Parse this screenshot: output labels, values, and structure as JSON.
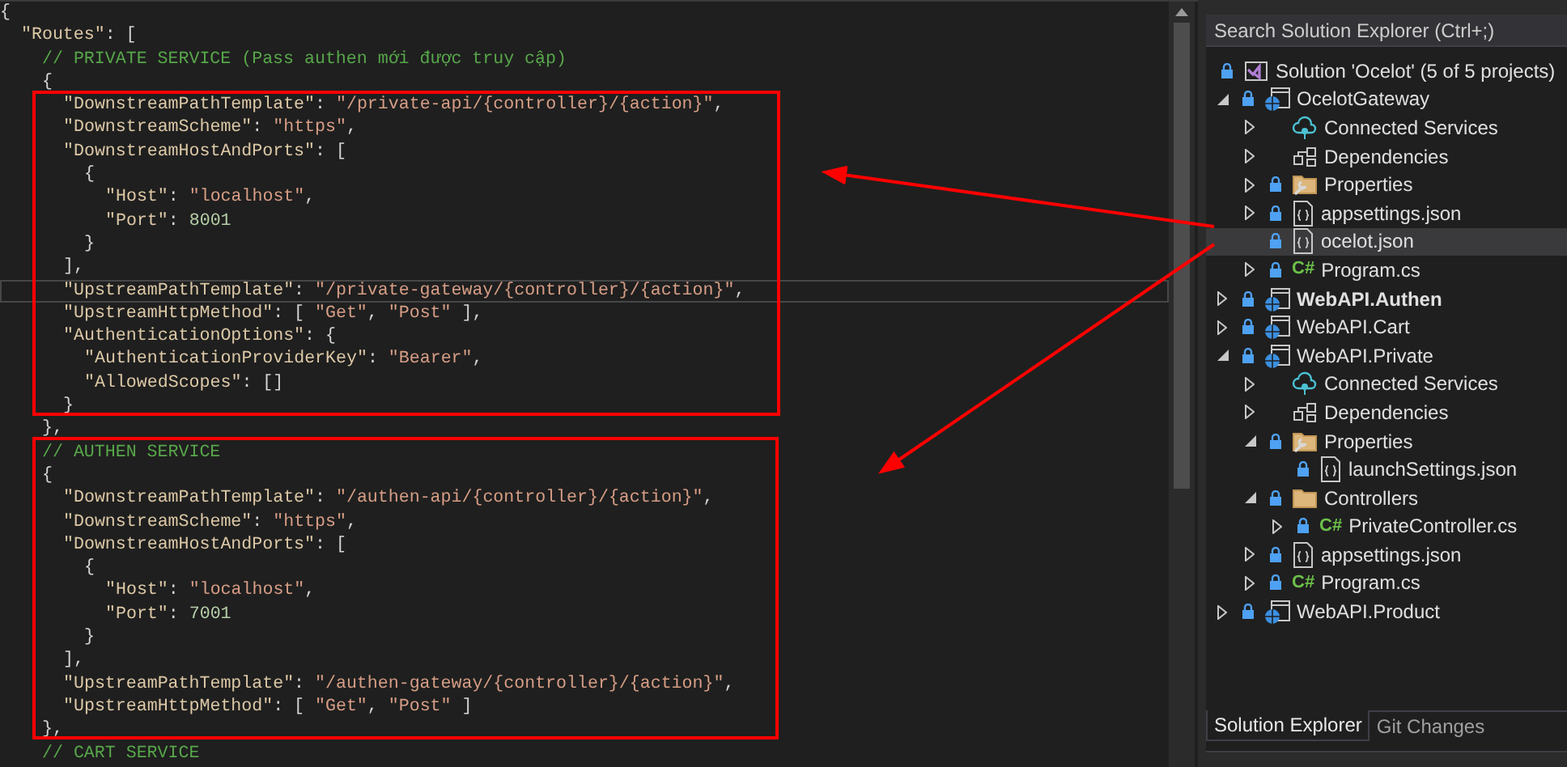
{
  "editor": {
    "lines": [
      {
        "tokens": [
          {
            "kind": "punct",
            "text": "{"
          }
        ],
        "children": [
          {
            "tokens": [
              {
                "kind": "key",
                "text": "\"Routes\""
              },
              {
                "kind": "punct",
                "text": ": ["
              }
            ],
            "children": [
              {
                "tokens": [
                  {
                    "kind": "comment",
                    "text": "// PRIVATE SERVICE (Pass authen mới được truy cập)"
                  }
                ]
              },
              {
                "tokens": [
                  {
                    "kind": "punct",
                    "text": "{"
                  }
                ],
                "children": [
                  {
                    "tokens": [
                      {
                        "kind": "key",
                        "text": "\"DownstreamPathTemplate\""
                      },
                      {
                        "kind": "punct",
                        "text": ": "
                      },
                      {
                        "kind": "string",
                        "text": "\"/private-api/{controller}/{action}\""
                      },
                      {
                        "kind": "punct",
                        "text": ","
                      }
                    ]
                  },
                  {
                    "tokens": [
                      {
                        "kind": "key",
                        "text": "\"DownstreamScheme\""
                      },
                      {
                        "kind": "punct",
                        "text": ": "
                      },
                      {
                        "kind": "string",
                        "text": "\"https\""
                      },
                      {
                        "kind": "punct",
                        "text": ","
                      }
                    ]
                  },
                  {
                    "tokens": [
                      {
                        "kind": "key",
                        "text": "\"DownstreamHostAndPorts\""
                      },
                      {
                        "kind": "punct",
                        "text": ": ["
                      }
                    ],
                    "children": [
                      {
                        "tokens": [
                          {
                            "kind": "punct",
                            "text": "{"
                          }
                        ],
                        "children": [
                          {
                            "tokens": [
                              {
                                "kind": "key",
                                "text": "\"Host\""
                              },
                              {
                                "kind": "punct",
                                "text": ": "
                              },
                              {
                                "kind": "string",
                                "text": "\"localhost\""
                              },
                              {
                                "kind": "punct",
                                "text": ","
                              }
                            ]
                          },
                          {
                            "tokens": [
                              {
                                "kind": "key",
                                "text": "\"Port\""
                              },
                              {
                                "kind": "punct",
                                "text": ": "
                              },
                              {
                                "kind": "number",
                                "text": "8001"
                              }
                            ]
                          }
                        ]
                      },
                      {
                        "tokens": [
                          {
                            "kind": "punct",
                            "text": "}"
                          }
                        ]
                      }
                    ]
                  },
                  {
                    "tokens": [
                      {
                        "kind": "punct",
                        "text": "],"
                      }
                    ]
                  },
                  {
                    "current": true,
                    "tokens": [
                      {
                        "kind": "key",
                        "text": "\"UpstreamPathTemplate\""
                      },
                      {
                        "kind": "punct",
                        "text": ": "
                      },
                      {
                        "kind": "string",
                        "text": "\"/private-gateway/{controller}/{action}\""
                      },
                      {
                        "kind": "punct",
                        "text": ","
                      }
                    ]
                  },
                  {
                    "tokens": [
                      {
                        "kind": "key",
                        "text": "\"UpstreamHttpMethod\""
                      },
                      {
                        "kind": "punct",
                        "text": ": [ "
                      },
                      {
                        "kind": "string",
                        "text": "\"Get\""
                      },
                      {
                        "kind": "punct",
                        "text": ", "
                      },
                      {
                        "kind": "string",
                        "text": "\"Post\""
                      },
                      {
                        "kind": "punct",
                        "text": " ],"
                      }
                    ]
                  },
                  {
                    "tokens": [
                      {
                        "kind": "key",
                        "text": "\"AuthenticationOptions\""
                      },
                      {
                        "kind": "punct",
                        "text": ": {"
                      }
                    ],
                    "children": [
                      {
                        "tokens": [
                          {
                            "kind": "key",
                            "text": "\"AuthenticationProviderKey\""
                          },
                          {
                            "kind": "punct",
                            "text": ": "
                          },
                          {
                            "kind": "string",
                            "text": "\"Bearer\""
                          },
                          {
                            "kind": "punct",
                            "text": ","
                          }
                        ]
                      },
                      {
                        "tokens": [
                          {
                            "kind": "key",
                            "text": "\"AllowedScopes\""
                          },
                          {
                            "kind": "punct",
                            "text": ": []"
                          }
                        ]
                      }
                    ]
                  },
                  {
                    "tokens": [
                      {
                        "kind": "punct",
                        "text": "}"
                      }
                    ]
                  }
                ]
              },
              {
                "tokens": [
                  {
                    "kind": "punct",
                    "text": "},"
                  }
                ]
              },
              {
                "tokens": [
                  {
                    "kind": "comment",
                    "text": "// AUTHEN SERVICE"
                  }
                ]
              },
              {
                "tokens": [
                  {
                    "kind": "punct",
                    "text": "{"
                  }
                ],
                "children": [
                  {
                    "tokens": [
                      {
                        "kind": "key",
                        "text": "\"DownstreamPathTemplate\""
                      },
                      {
                        "kind": "punct",
                        "text": ": "
                      },
                      {
                        "kind": "string",
                        "text": "\"/authen-api/{controller}/{action}\""
                      },
                      {
                        "kind": "punct",
                        "text": ","
                      }
                    ]
                  },
                  {
                    "tokens": [
                      {
                        "kind": "key",
                        "text": "\"DownstreamScheme\""
                      },
                      {
                        "kind": "punct",
                        "text": ": "
                      },
                      {
                        "kind": "string",
                        "text": "\"https\""
                      },
                      {
                        "kind": "punct",
                        "text": ","
                      }
                    ]
                  },
                  {
                    "tokens": [
                      {
                        "kind": "key",
                        "text": "\"DownstreamHostAndPorts\""
                      },
                      {
                        "kind": "punct",
                        "text": ": ["
                      }
                    ],
                    "children": [
                      {
                        "tokens": [
                          {
                            "kind": "punct",
                            "text": "{"
                          }
                        ],
                        "children": [
                          {
                            "tokens": [
                              {
                                "kind": "key",
                                "text": "\"Host\""
                              },
                              {
                                "kind": "punct",
                                "text": ": "
                              },
                              {
                                "kind": "string",
                                "text": "\"localhost\""
                              },
                              {
                                "kind": "punct",
                                "text": ","
                              }
                            ]
                          },
                          {
                            "tokens": [
                              {
                                "kind": "key",
                                "text": "\"Port\""
                              },
                              {
                                "kind": "punct",
                                "text": ": "
                              },
                              {
                                "kind": "number",
                                "text": "7001"
                              }
                            ]
                          }
                        ]
                      },
                      {
                        "tokens": [
                          {
                            "kind": "punct",
                            "text": "}"
                          }
                        ]
                      }
                    ]
                  },
                  {
                    "tokens": [
                      {
                        "kind": "punct",
                        "text": "],"
                      }
                    ]
                  },
                  {
                    "tokens": [
                      {
                        "kind": "key",
                        "text": "\"UpstreamPathTemplate\""
                      },
                      {
                        "kind": "punct",
                        "text": ": "
                      },
                      {
                        "kind": "string",
                        "text": "\"/authen-gateway/{controller}/{action}\""
                      },
                      {
                        "kind": "punct",
                        "text": ","
                      }
                    ]
                  },
                  {
                    "tokens": [
                      {
                        "kind": "key",
                        "text": "\"UpstreamHttpMethod\""
                      },
                      {
                        "kind": "punct",
                        "text": ": [ "
                      },
                      {
                        "kind": "string",
                        "text": "\"Get\""
                      },
                      {
                        "kind": "punct",
                        "text": ", "
                      },
                      {
                        "kind": "string",
                        "text": "\"Post\""
                      },
                      {
                        "kind": "punct",
                        "text": " ]"
                      }
                    ]
                  }
                ]
              },
              {
                "tokens": [
                  {
                    "kind": "punct",
                    "text": "},"
                  }
                ]
              },
              {
                "tokens": [
                  {
                    "kind": "comment",
                    "text": "// CART SERVICE"
                  }
                ]
              }
            ]
          }
        ]
      }
    ]
  },
  "solution_explorer": {
    "search": {
      "placeholder": "Search Solution Explorer (Ctrl+;)"
    },
    "tree": [
      {
        "label": "Solution 'Ocelot' (5 of 5 projects)",
        "kind": "solution",
        "locked": true,
        "selected": false,
        "children": [
          {
            "label": "OcelotGateway",
            "kind": "project",
            "locked": true,
            "expanded": true,
            "startup": false,
            "selected": false,
            "children": [
              {
                "label": "Connected Services",
                "kind": "connected",
                "locked": false,
                "expanded": false,
                "selected": false
              },
              {
                "label": "Dependencies",
                "kind": "dependencies",
                "locked": false,
                "expanded": false,
                "selected": false
              },
              {
                "label": "Properties",
                "kind": "properties",
                "locked": true,
                "expanded": false,
                "selected": false
              },
              {
                "label": "appsettings.json",
                "kind": "json",
                "locked": true,
                "expanded": false,
                "selected": false
              },
              {
                "label": "ocelot.json",
                "kind": "json",
                "locked": true,
                "selected": true
              },
              {
                "label": "Program.cs",
                "kind": "csharp",
                "badge": "C#",
                "locked": true,
                "expanded": false,
                "selected": false
              }
            ]
          },
          {
            "label": "WebAPI.Authen",
            "kind": "project",
            "locked": true,
            "expanded": false,
            "startup": true,
            "selected": false
          },
          {
            "label": "WebAPI.Cart",
            "kind": "project",
            "locked": true,
            "expanded": false,
            "startup": false,
            "selected": false
          },
          {
            "label": "WebAPI.Private",
            "kind": "project",
            "locked": true,
            "expanded": true,
            "startup": false,
            "selected": false,
            "children": [
              {
                "label": "Connected Services",
                "kind": "connected",
                "locked": false,
                "expanded": false,
                "selected": false
              },
              {
                "label": "Dependencies",
                "kind": "dependencies",
                "locked": false,
                "expanded": false,
                "selected": false
              },
              {
                "label": "Properties",
                "kind": "properties",
                "locked": true,
                "expanded": true,
                "selected": false,
                "children": [
                  {
                    "label": "launchSettings.json",
                    "kind": "json",
                    "locked": true,
                    "selected": false
                  }
                ]
              },
              {
                "label": "Controllers",
                "kind": "folder",
                "locked": true,
                "expanded": true,
                "selected": false,
                "children": [
                  {
                    "label": "PrivateController.cs",
                    "kind": "csharp",
                    "badge": "C#",
                    "locked": true,
                    "expanded": false,
                    "selected": false
                  }
                ]
              },
              {
                "label": "appsettings.json",
                "kind": "json",
                "locked": true,
                "expanded": false,
                "selected": false
              },
              {
                "label": "Program.cs",
                "kind": "csharp",
                "badge": "C#",
                "locked": true,
                "expanded": false,
                "selected": false
              }
            ]
          },
          {
            "label": "WebAPI.Product",
            "kind": "project",
            "locked": true,
            "expanded": false,
            "startup": false,
            "selected": false
          }
        ]
      }
    ],
    "tabs": [
      {
        "label": "Solution Explorer",
        "selected": true
      },
      {
        "label": "Git Changes",
        "selected": false
      }
    ]
  }
}
